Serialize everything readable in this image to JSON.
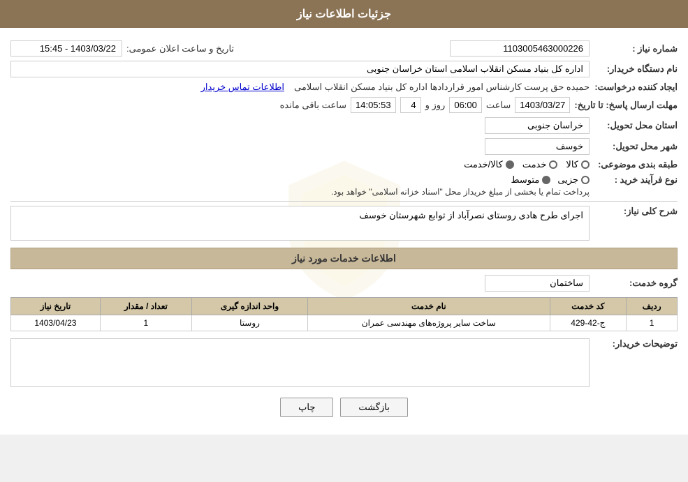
{
  "header": {
    "title": "جزئیات اطلاعات نیاز"
  },
  "fields": {
    "need_number_label": "شماره نیاز :",
    "need_number_value": "1103005463000226",
    "buyer_org_label": "نام دستگاه خریدار:",
    "buyer_org_value": "اداره کل بنیاد مسکن انقلاب اسلامی استان خراسان جنوبی",
    "creator_label": "ایجاد کننده درخواست:",
    "creator_value": "حمیده حق پرست کارشناس امور قراردادها اداره کل بنیاد مسکن انقلاب اسلامی",
    "contact_link": "اطلاعات تماس خریدار",
    "deadline_label": "مهلت ارسال پاسخ: تا تاریخ:",
    "deadline_date": "1403/03/27",
    "deadline_time_label": "ساعت",
    "deadline_time": "06:00",
    "remaining_days_label": "روز و",
    "remaining_days": "4",
    "remaining_time_label": "ساعت باقی مانده",
    "remaining_time": "14:05:53",
    "announce_label": "تاریخ و ساعت اعلان عمومی:",
    "announce_value": "1403/03/22 - 15:45",
    "province_label": "استان محل تحویل:",
    "province_value": "خراسان جنوبی",
    "city_label": "شهر محل تحویل:",
    "city_value": "خوسف",
    "category_label": "طبقه بندی موضوعی:",
    "category_options": [
      "کالا",
      "خدمت",
      "کالا/خدمت"
    ],
    "category_selected": "کالا/خدمت",
    "purchase_type_label": "نوع فرآیند خرید :",
    "purchase_options": [
      "جزیی",
      "متوسط"
    ],
    "purchase_note": "پرداخت تمام یا بخشی از مبلغ خریداز محل \"اسناد خزانه اسلامی\" خواهد بود.",
    "description_label": "شرح کلی نیاز:",
    "description_value": "اجرای طرح هادی روستای نصرآباد از توابع شهرستان خوسف",
    "services_section_title": "اطلاعات خدمات مورد نیاز",
    "service_group_label": "گروه خدمت:",
    "service_group_value": "ساختمان",
    "table": {
      "headers": [
        "ردیف",
        "کد خدمت",
        "نام خدمت",
        "واحد اندازه گیری",
        "تعداد / مقدار",
        "تاریخ نیاز"
      ],
      "rows": [
        {
          "row": "1",
          "service_code": "ج-42-429",
          "service_name": "ساخت سایر پروژه‌های مهندسی عمران",
          "unit": "روستا",
          "quantity": "1",
          "date": "1403/04/23"
        }
      ]
    },
    "buyer_notes_label": "توضیحات خریدار:",
    "buyer_notes_value": ""
  },
  "buttons": {
    "print_label": "چاپ",
    "back_label": "بازگشت"
  }
}
